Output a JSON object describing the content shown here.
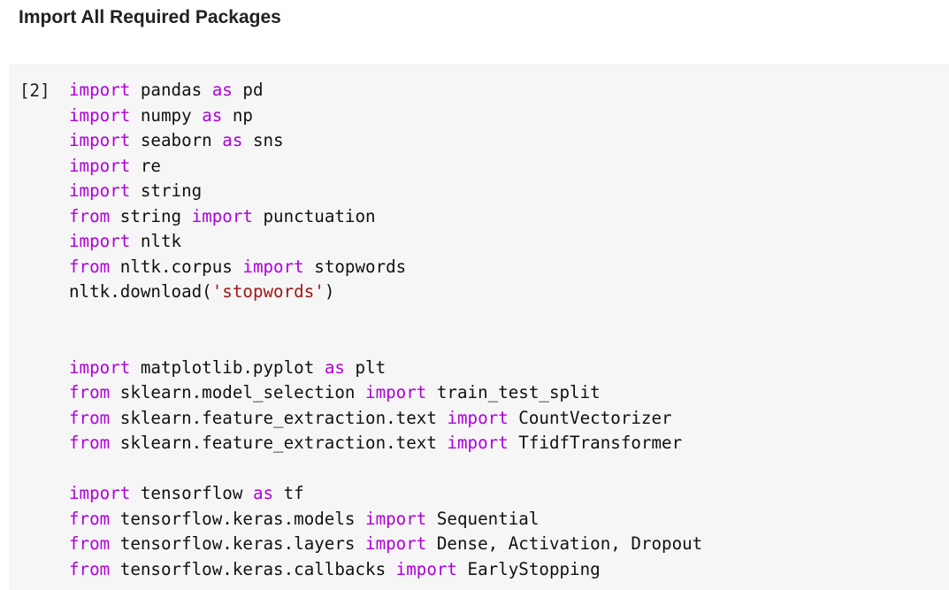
{
  "section": {
    "title": "Import All Required Packages"
  },
  "cell": {
    "execution_count": "[2]",
    "lines": [
      [
        [
          "kw",
          "import"
        ],
        [
          "id",
          " pandas "
        ],
        [
          "kw",
          "as"
        ],
        [
          "id",
          " pd"
        ]
      ],
      [
        [
          "kw",
          "import"
        ],
        [
          "id",
          " numpy "
        ],
        [
          "kw",
          "as"
        ],
        [
          "id",
          " np"
        ]
      ],
      [
        [
          "kw",
          "import"
        ],
        [
          "id",
          " seaborn "
        ],
        [
          "kw",
          "as"
        ],
        [
          "id",
          " sns"
        ]
      ],
      [
        [
          "kw",
          "import"
        ],
        [
          "id",
          " re"
        ]
      ],
      [
        [
          "kw",
          "import"
        ],
        [
          "id",
          " string"
        ]
      ],
      [
        [
          "kw",
          "from"
        ],
        [
          "id",
          " string "
        ],
        [
          "kw",
          "import"
        ],
        [
          "id",
          " punctuation"
        ]
      ],
      [
        [
          "kw",
          "import"
        ],
        [
          "id",
          " nltk"
        ]
      ],
      [
        [
          "kw",
          "from"
        ],
        [
          "id",
          " nltk.corpus "
        ],
        [
          "kw",
          "import"
        ],
        [
          "id",
          " stopwords"
        ]
      ],
      [
        [
          "id",
          "nltk.download("
        ],
        [
          "str",
          "'stopwords'"
        ],
        [
          "id",
          ")"
        ]
      ],
      [],
      [],
      [
        [
          "kw",
          "import"
        ],
        [
          "id",
          " matplotlib.pyplot "
        ],
        [
          "kw",
          "as"
        ],
        [
          "id",
          " plt"
        ]
      ],
      [
        [
          "kw",
          "from"
        ],
        [
          "id",
          " sklearn.model_selection "
        ],
        [
          "kw",
          "import"
        ],
        [
          "id",
          " train_test_split"
        ]
      ],
      [
        [
          "kw",
          "from"
        ],
        [
          "id",
          " sklearn.feature_extraction.text "
        ],
        [
          "kw",
          "import"
        ],
        [
          "id",
          " CountVectorizer"
        ]
      ],
      [
        [
          "kw",
          "from"
        ],
        [
          "id",
          " sklearn.feature_extraction.text "
        ],
        [
          "kw",
          "import"
        ],
        [
          "id",
          " TfidfTransformer"
        ]
      ],
      [],
      [
        [
          "kw",
          "import"
        ],
        [
          "id",
          " tensorflow "
        ],
        [
          "kw",
          "as"
        ],
        [
          "id",
          " tf"
        ]
      ],
      [
        [
          "kw",
          "from"
        ],
        [
          "id",
          " tensorflow.keras.models "
        ],
        [
          "kw",
          "import"
        ],
        [
          "id",
          " Sequential"
        ]
      ],
      [
        [
          "kw",
          "from"
        ],
        [
          "id",
          " tensorflow.keras.layers "
        ],
        [
          "kw",
          "import"
        ],
        [
          "id",
          " Dense, Activation, Dropout"
        ]
      ],
      [
        [
          "kw",
          "from"
        ],
        [
          "id",
          " tensorflow.keras.callbacks "
        ],
        [
          "kw",
          "import"
        ],
        [
          "id",
          " EarlyStopping"
        ]
      ]
    ]
  },
  "colors": {
    "keyword": "#af00db",
    "string": "#a31515",
    "text": "#111111",
    "cell_background": "#f6f6f6"
  }
}
